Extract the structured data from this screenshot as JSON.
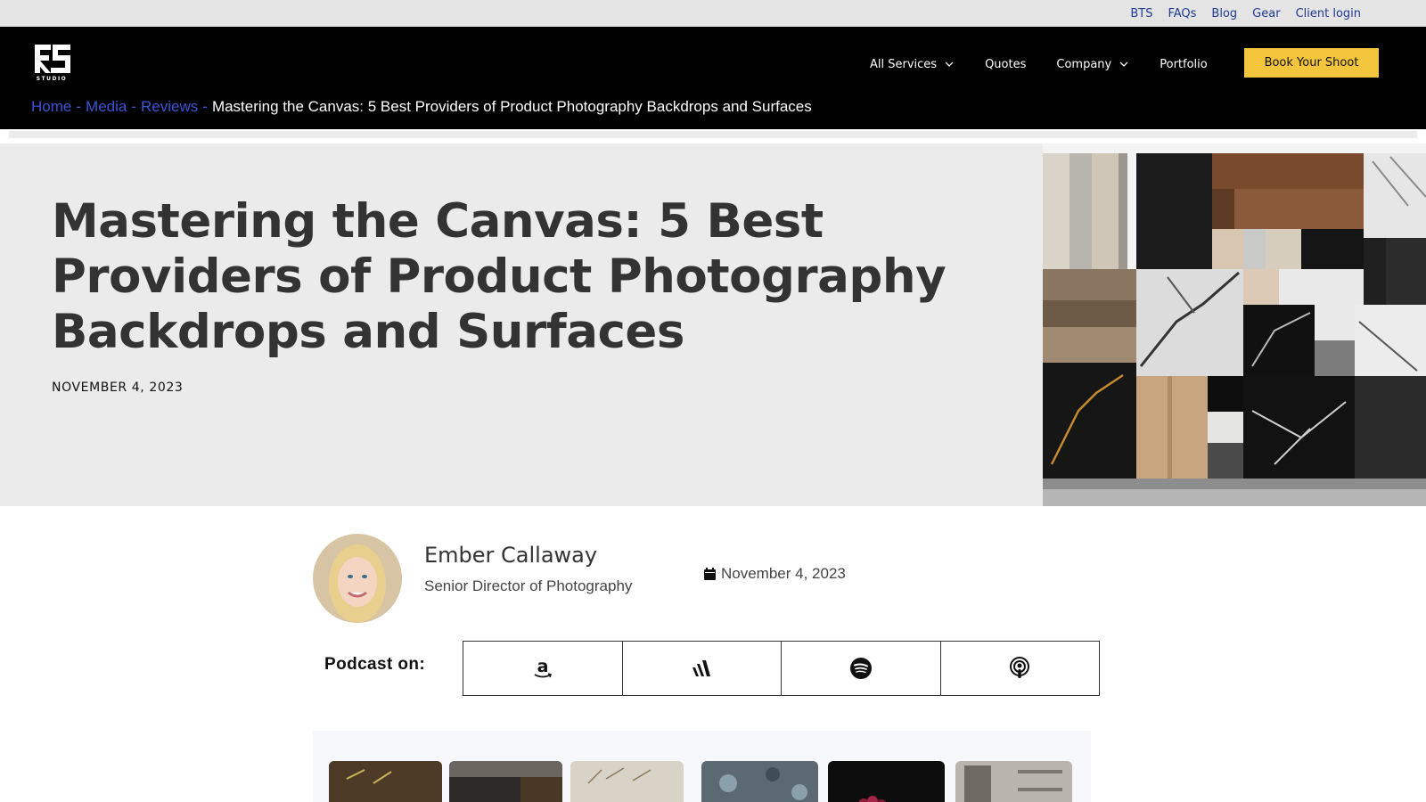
{
  "topbar": {
    "links": [
      "BTS",
      "FAQs",
      "Blog",
      "Gear",
      "Client login"
    ]
  },
  "header": {
    "logo_text": "STUDIO",
    "nav": {
      "all_services": "All Services",
      "quotes": "Quotes",
      "company": "Company",
      "portfolio": "Portfolio"
    },
    "cta_label": "Book Your Shoot",
    "cta_color": "#f2c53d"
  },
  "breadcrumb": {
    "home": "Home",
    "media": "Media",
    "reviews": "Reviews",
    "separator": "-",
    "current": "Mastering the Canvas: 5 Best Providers of Product Photography Backdrops and Surfaces"
  },
  "hero": {
    "title": "Mastering the Canvas: 5 Best Providers of Product Photography Backdrops and Surfaces",
    "date": "NOVEMBER 4, 2023"
  },
  "author": {
    "name": "Ember Callaway",
    "role": "Senior Director of Photography",
    "post_date": "November 4, 2023"
  },
  "podcast": {
    "label": "Podcast on:",
    "platforms": [
      "amazon-music-icon",
      "audible-icon",
      "spotify-icon",
      "apple-podcasts-icon"
    ]
  },
  "colors": {
    "link_blue": "#1f3a93",
    "breadcrumb_blue": "#3c55d6",
    "header_bg": "#000000",
    "hero_bg": "#ebebeb"
  }
}
